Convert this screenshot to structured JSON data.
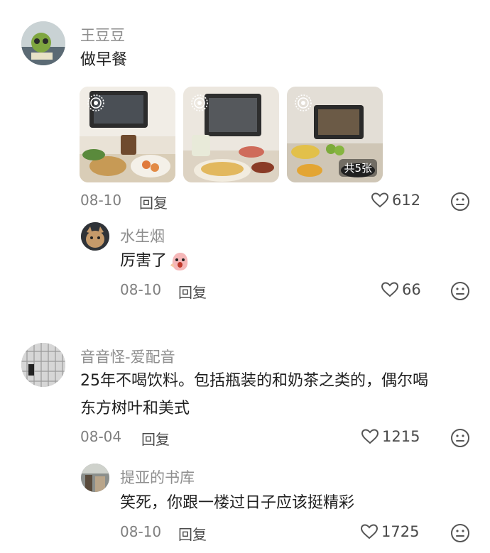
{
  "comments": [
    {
      "username": "王豆豆",
      "text": "做早餐",
      "image_more": "共5张",
      "date": "08-10",
      "reply_label": "回复",
      "likes": "612",
      "replies": [
        {
          "username": "水生烟",
          "text": "厉害了",
          "emoji": "shocked-face-emoji",
          "date": "08-10",
          "reply_label": "回复",
          "likes": "66"
        }
      ]
    },
    {
      "username": "音音怪-爱配音",
      "text_line1": "25年不喝饮料。包括瓶装的和奶茶之类的，偶尔喝",
      "text_line2": "东方树叶和美式",
      "date": "08-04",
      "reply_label": "回复",
      "likes": "1215",
      "replies": [
        {
          "username": "提亚的书库",
          "text": "笑死，你跟一楼过日子应该挺精彩",
          "date": "08-10",
          "reply_label": "回复",
          "likes": "1725"
        }
      ]
    }
  ],
  "icons": {
    "like": "heart-outline-icon",
    "dislike": "unhappy-face-icon",
    "live_photo": "live-photo-icon"
  },
  "colors": {
    "name": "#8e8e8e",
    "text": "#1f1f1f",
    "meta": "#7f7f7f"
  }
}
